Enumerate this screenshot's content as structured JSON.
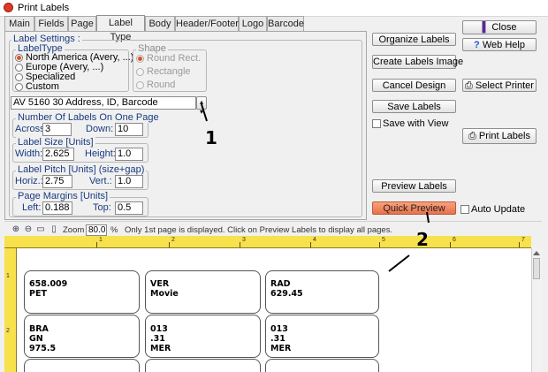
{
  "window": {
    "title": "Print Labels"
  },
  "tabs": [
    "Main",
    "Fields",
    "Page",
    "Label Type",
    "Body",
    "Header/Footer",
    "Logo",
    "Barcode"
  ],
  "label_settings": {
    "legend": "Label Settings :",
    "label_type": {
      "legend": "LabelType",
      "options": [
        "North America (Avery, ...)",
        "Europe (Avery, ...)",
        "Specialized",
        "Custom"
      ],
      "selected": "North America (Avery, ...)"
    },
    "shape": {
      "legend": "Shape",
      "options": [
        "Round Rect.",
        "Rectangle",
        "Round"
      ],
      "selected": "Round Rect."
    },
    "template_select": "AV 5160  30  Address, ID, Barcode",
    "labels_per_page": {
      "legend": "Number Of Labels On One Page",
      "across_label": "Across:",
      "across": "3",
      "down_label": "Down:",
      "down": "10"
    },
    "label_size": {
      "legend": "Label Size [Units]",
      "width_label": "Width:",
      "width": "2.625",
      "height_label": "Height:",
      "height": "1.0"
    },
    "label_pitch": {
      "legend": "Label Pitch [Units] (size+gap)",
      "horiz_label": "Horiz.:",
      "horiz": "2.75",
      "vert_label": "Vert.:",
      "vert": "1.0"
    },
    "page_margins": {
      "legend": "Page Margins [Units]",
      "left_label": "Left:",
      "left": "0.188",
      "top_label": "Top:",
      "top": "0.5"
    }
  },
  "actions": {
    "organize": "Organize Labels",
    "create_image": "Create Labels Image",
    "cancel": "Cancel Design",
    "save": "Save Labels",
    "save_with_view": "Save with View",
    "preview": "Preview Labels",
    "quick_preview": "Quick Preview",
    "auto_update": "Auto Update",
    "close": "Close",
    "web_help": "Web Help",
    "select_printer": "Select Printer",
    "print_labels": "Print Labels"
  },
  "toolbar": {
    "zoom_label": "Zoom",
    "zoom_value": "80.0",
    "zoom_unit": "%",
    "info": "Only 1st page is displayed. Click on Preview Labels to display all pages."
  },
  "ruler": {
    "top_numbers": [
      "1",
      "2",
      "3",
      "4",
      "5",
      "6",
      "7"
    ],
    "left_numbers": [
      "1",
      "2"
    ]
  },
  "preview_labels": [
    [
      "658.009",
      "PET"
    ],
    [
      "VER",
      "Movie"
    ],
    [
      "RAD",
      "629.45"
    ],
    [
      "BRA",
      "GN",
      "975.5"
    ],
    [
      "013",
      ".31",
      "MER"
    ],
    [
      "013",
      ".31",
      "MER"
    ]
  ],
  "annotations": [
    "1",
    "2"
  ],
  "colors": {
    "accent_orange": "#e8704c",
    "ruler_yellow": "#f7e14c",
    "legend_blue": "#1a3a80"
  }
}
